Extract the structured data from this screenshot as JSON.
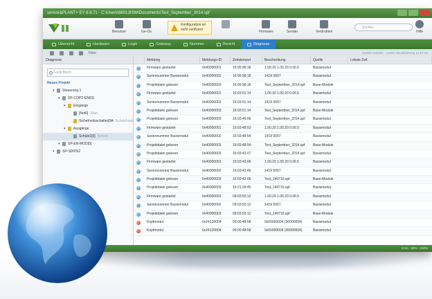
{
  "window": {
    "title": "sensor&PLANT+ EY 8.8.71 - C:\\Users\\86013ISW\\Documents\\Test_September_2014.spf"
  },
  "ribbon": {
    "buttons": [
      {
        "label": "Benutzer",
        "icon": "user-icon"
      },
      {
        "label": "Ge-Oo",
        "icon": "device-icon"
      },
      {
        "label": "Firmware",
        "icon": "firmware-icon"
      },
      {
        "label": "Sender",
        "icon": "sender-icon"
      },
      {
        "label": "Verdrahten",
        "icon": "wiring-icon"
      },
      {
        "label": "Hilfe",
        "icon": "help-icon"
      }
    ],
    "warning": "Konfiguration ist nicht verifiziert",
    "search_placeholder": "Suchen"
  },
  "tabs": [
    {
      "label": "Übersicht",
      "active": false
    },
    {
      "label": "Hardware",
      "active": false
    },
    {
      "label": "Logik",
      "active": false
    },
    {
      "label": "Gateway",
      "active": false
    },
    {
      "label": "Nummer",
      "active": false
    },
    {
      "label": "Bericht",
      "active": false
    },
    {
      "label": "Diagnose",
      "active": true
    }
  ],
  "toolbar": {
    "filter_label": "Filter",
    "right_info": "Modell 10053G · Letzte Aktualisierung 14:07:22"
  },
  "sidebar": {
    "header": "Diagnose",
    "filter_placeholder": "Gerät filtern",
    "tree": [
      {
        "label": "Neues Projekt",
        "level": 0,
        "type": "head"
      },
      {
        "label": "Steuerung 1",
        "level": 1,
        "type": "node"
      },
      {
        "label": "SP-COP2-ENI(0)",
        "level": 2,
        "type": "node"
      },
      {
        "label": "Eingänge",
        "level": 3,
        "type": "warn"
      },
      {
        "label": "[Not0]",
        "sub": "Start",
        "level": 4,
        "type": "leaf"
      },
      {
        "label": "Sicherheitsschalter[0A",
        "sub": "Schutzhaube",
        "level": 4,
        "type": "warn-leaf"
      },
      {
        "label": "Ausgänge",
        "level": 3,
        "type": "warn"
      },
      {
        "label": "Schütz1[0]",
        "sub": "Kessel",
        "level": 4,
        "type": "leaf",
        "selected": true
      },
      {
        "label": "SP-EN-MOD[0]",
        "level": 2,
        "type": "node"
      },
      {
        "label": "SP-SDIO52",
        "level": 1,
        "type": "node"
      }
    ]
  },
  "table": {
    "columns": [
      "",
      "Meldung",
      "Meldungs-ID",
      "Zeitstempel",
      "Beschreibung",
      "Quelle",
      "Lokale Zeit"
    ],
    "rows": [
      {
        "level": "info",
        "meldung": "Firmware gestartet",
        "id": "0x40000001",
        "zeit": "16:05:58:18",
        "beschreibung": "1.00.20 1.00.20 0.06.5",
        "quelle": "Basismodul"
      },
      {
        "level": "info",
        "meldung": "Seriennummer Basismodul",
        "id": "0x40000002",
        "zeit": "16:05:58:18",
        "beschreibung": "1419 0057",
        "quelle": "Basismodul"
      },
      {
        "level": "info",
        "meldung": "Projektdatei gelesen",
        "id": "0x40000003",
        "zeit": "16:05:58:18",
        "beschreibung": "Test_September_2014.spf",
        "quelle": "Base-Module"
      },
      {
        "level": "info",
        "meldung": "Firmware gestartet",
        "id": "0x40000001",
        "zeit": "16:03:51:14",
        "beschreibung": "1.00.20 1.00.20 0.06.5",
        "quelle": "Basismodul"
      },
      {
        "level": "info",
        "meldung": "Seriennummer Basismodul",
        "id": "0x40000002",
        "zeit": "16:03:51:14",
        "beschreibung": "1419 0057",
        "quelle": "Basismodul"
      },
      {
        "level": "info",
        "meldung": "Projektdatei gelesen",
        "id": "0x40000003",
        "zeit": "16:03:51:14",
        "beschreibung": "Test_September_2014.spf",
        "quelle": "Base-Module"
      },
      {
        "level": "info",
        "meldung": "Projektdatei gelesen",
        "id": "0x40000003",
        "zeit": "16:03:49:06",
        "beschreibung": "Test_September_2014.spf",
        "quelle": "Basismodul"
      },
      {
        "level": "info",
        "meldung": "Firmware gestartet",
        "id": "0x40000001",
        "zeit": "16:03:48:53",
        "beschreibung": "1.00.20 1.00.20 0.06.5",
        "quelle": "Basismodul"
      },
      {
        "level": "info",
        "meldung": "Seriennummer Basismodul",
        "id": "0x40000002",
        "zeit": "16:03:48:54",
        "beschreibung": "1419 0057",
        "quelle": "Basismodul"
      },
      {
        "level": "info",
        "meldung": "Projektdatei gelesen",
        "id": "0x40000003",
        "zeit": "16:03:48:54",
        "beschreibung": "Test_September_2014.spf",
        "quelle": "Base-Module"
      },
      {
        "level": "info",
        "meldung": "Projektdatei gelesen",
        "id": "0x40000003",
        "zeit": "16:03:43:07",
        "beschreibung": "Test_September_2014.spf",
        "quelle": "Basismodul"
      },
      {
        "level": "info",
        "meldung": "Firmware gestartet",
        "id": "0x40000001",
        "zeit": "16:03:43:06",
        "beschreibung": "1.00.20 1.00.20 0.06.5",
        "quelle": "Basismodul"
      },
      {
        "level": "info",
        "meldung": "Seriennummer Basismodul",
        "id": "0x40000002",
        "zeit": "16:03:43:06",
        "beschreibung": "1419 0057",
        "quelle": "Basismodul"
      },
      {
        "level": "info",
        "meldung": "Projektdatei gelesen",
        "id": "0x40000003",
        "zeit": "16:03:43:06",
        "beschreibung": "Test_140716.spf",
        "quelle": "Base-Module"
      },
      {
        "level": "info",
        "meldung": "Projektdatei gelesen",
        "id": "0x40000003",
        "zeit": "15:21:39:45",
        "beschreibung": "Test_140716.spf",
        "quelle": "Basismodul"
      },
      {
        "level": "info",
        "meldung": "Firmware gestartet",
        "id": "0x40000001",
        "zeit": "09:03:53:12",
        "beschreibung": "1.00.20 1.00.20 0.06.5",
        "quelle": "Basismodul"
      },
      {
        "level": "info",
        "meldung": "Seriennummer Basismodul",
        "id": "0x40000002",
        "zeit": "09:03:53:12",
        "beschreibung": "1419 0057",
        "quelle": "Basismodul"
      },
      {
        "level": "info",
        "meldung": "Projektdatei gelesen",
        "id": "0x40000003",
        "zeit": "09:03:53:12",
        "beschreibung": "Test_140716.spf",
        "quelle": "Base-Module"
      },
      {
        "level": "err",
        "meldung": "Kopfmodul",
        "id": "0x24120004",
        "zeit": "09:00:48:58",
        "beschreibung": "0x00000004 (00000004)",
        "quelle": "Basismodul"
      },
      {
        "level": "err",
        "meldung": "Kopfmodul",
        "id": "0x24120004",
        "zeit": "09:00:48:58",
        "beschreibung": "0x00000004 (00000004)",
        "quelle": "Basismodul"
      }
    ]
  },
  "statusbar": {
    "text": "4 ms · 60% · 100%"
  }
}
